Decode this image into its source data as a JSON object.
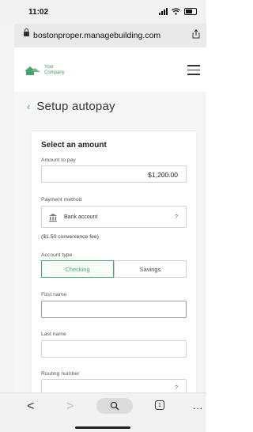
{
  "status": {
    "time": "11:02",
    "location_icon": "location-arrow-icon",
    "signal_icon": "cellular-signal-icon",
    "wifi_icon": "wifi-icon",
    "battery_icon": "battery-icon"
  },
  "browser": {
    "url": "bostonproper.managebuilding.com",
    "lock_icon": "lock-icon",
    "share_icon": "share-icon"
  },
  "site": {
    "logo_line1": "Your",
    "logo_line2": "Company",
    "menu_icon": "hamburger-menu-icon",
    "brand_color": "#47a36b"
  },
  "page": {
    "back_icon": "chevron-left-icon",
    "title": "Setup autopay"
  },
  "form": {
    "heading": "Select an amount",
    "amount_label": "Amount to pay",
    "amount_value": "$1,200.00",
    "payment_method_label": "Payment method",
    "payment_method_value": "Bank account",
    "payment_method_help": "?",
    "fee_note": "($1.50 convenience fee)",
    "account_type_label": "Account type",
    "account_types": [
      "Checking",
      "Savings"
    ],
    "account_type_selected": "Checking",
    "first_name_label": "First name",
    "first_name_value": "",
    "last_name_label": "Last name",
    "last_name_value": "",
    "routing_label": "Routing number",
    "routing_help": "?"
  },
  "toolbar": {
    "back": "<",
    "forward": ">",
    "search_icon": "search-icon",
    "tabs_count": "1",
    "more": "..."
  }
}
